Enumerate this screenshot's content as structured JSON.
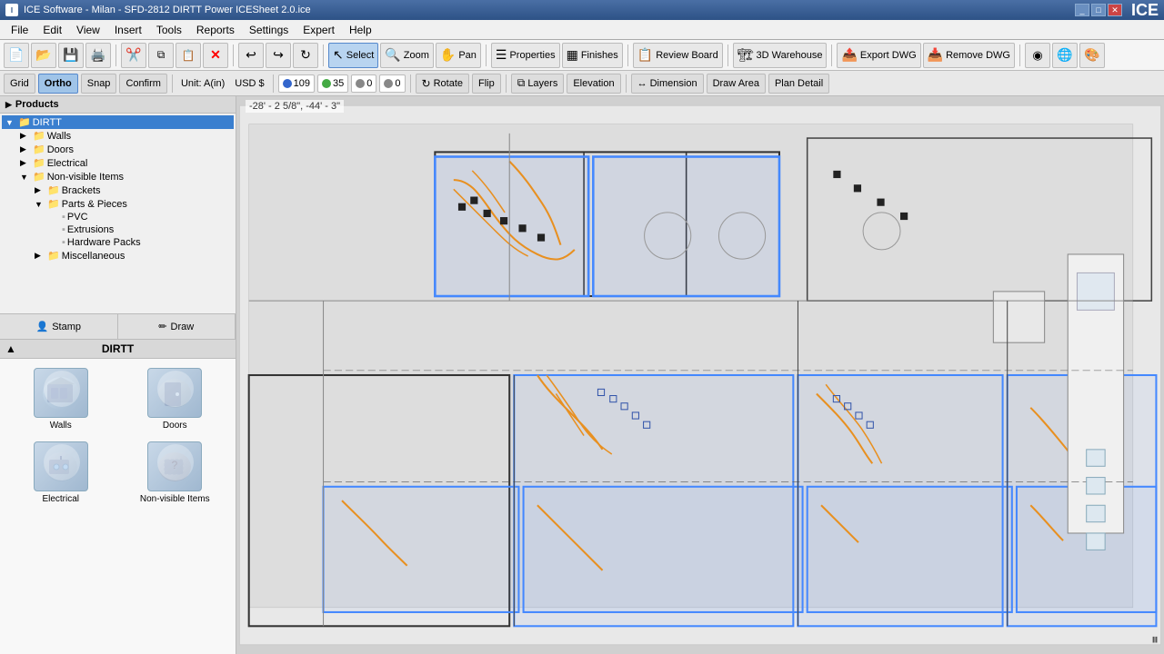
{
  "titleBar": {
    "appName": "ICE Software - Milan - SFD-2812 DIRTT Power ICESheet 2.0.ice",
    "logo": "ICE",
    "winBtns": [
      "_",
      "□",
      "✕"
    ]
  },
  "menuBar": {
    "items": [
      "File",
      "Edit",
      "View",
      "Insert",
      "Tools",
      "Reports",
      "Settings",
      "Expert",
      "Help"
    ]
  },
  "toolbar": {
    "buttons": [
      {
        "id": "new",
        "icon": "📄",
        "label": ""
      },
      {
        "id": "open",
        "icon": "📂",
        "label": ""
      },
      {
        "id": "save",
        "icon": "💾",
        "label": ""
      },
      {
        "id": "print",
        "icon": "🖨️",
        "label": ""
      },
      {
        "id": "sep1"
      },
      {
        "id": "cut",
        "icon": "✂️",
        "label": ""
      },
      {
        "id": "copy",
        "icon": "📋",
        "label": ""
      },
      {
        "id": "paste",
        "icon": "📌",
        "label": ""
      },
      {
        "id": "delete",
        "icon": "✕",
        "label": "",
        "color": "red"
      },
      {
        "id": "sep2"
      },
      {
        "id": "undo",
        "icon": "↩",
        "label": ""
      },
      {
        "id": "redo",
        "icon": "↪",
        "label": ""
      },
      {
        "id": "refresh",
        "icon": "↻",
        "label": ""
      },
      {
        "id": "sep3"
      },
      {
        "id": "select",
        "icon": "↖",
        "label": "Select",
        "active": true
      },
      {
        "id": "zoom",
        "icon": "🔍",
        "label": "Zoom"
      },
      {
        "id": "pan",
        "icon": "✋",
        "label": "Pan"
      },
      {
        "id": "sep4"
      },
      {
        "id": "properties",
        "icon": "≡",
        "label": "Properties"
      },
      {
        "id": "finishes",
        "icon": "▦",
        "label": "Finishes"
      },
      {
        "id": "sep5"
      },
      {
        "id": "reviewboard",
        "icon": "📋",
        "label": "Review Board"
      },
      {
        "id": "sep6"
      },
      {
        "id": "3dwarehouse",
        "icon": "🏗",
        "label": "3D Warehouse"
      },
      {
        "id": "sep7"
      },
      {
        "id": "exportdwg",
        "icon": "📤",
        "label": "Export DWG"
      },
      {
        "id": "removedwg",
        "icon": "📥",
        "label": "Remove DWG"
      },
      {
        "id": "sep8"
      },
      {
        "id": "vr",
        "icon": "◉",
        "label": ""
      },
      {
        "id": "globe",
        "icon": "🌐",
        "label": ""
      },
      {
        "id": "color",
        "icon": "🎨",
        "label": ""
      }
    ]
  },
  "actionBar": {
    "gridBtn": "Grid",
    "orthoBtn": "Ortho",
    "snapBtn": "Snap",
    "confirmBtn": "Confirm",
    "unit": "Unit: A(in)",
    "currency": "USD $",
    "counter1": {
      "icon": "🔵",
      "value": "109"
    },
    "counter2": {
      "icon": "🟢",
      "value": "35"
    },
    "counter3": {
      "icon": "⬛",
      "value": "0"
    },
    "counter4": {
      "icon": "⬛",
      "value": "0"
    },
    "rotateBtn": "Rotate",
    "flipBtn": "Flip",
    "layersBtn": "Layers",
    "elevationBtn": "Elevation",
    "dimensionBtn": "Dimension",
    "drawAreaBtn": "Draw Area",
    "planDetailBtn": "Plan Detail"
  },
  "leftPanel": {
    "header": "Products",
    "treeItems": [
      {
        "id": "dirtt",
        "label": "DIRTT",
        "indent": 0,
        "selected": true,
        "expanded": true,
        "type": "folder"
      },
      {
        "id": "walls",
        "label": "Walls",
        "indent": 1,
        "type": "folder"
      },
      {
        "id": "doors",
        "label": "Doors",
        "indent": 1,
        "type": "folder"
      },
      {
        "id": "electrical",
        "label": "Electrical",
        "indent": 1,
        "type": "folder"
      },
      {
        "id": "nonvisible",
        "label": "Non-visible Items",
        "indent": 1,
        "expanded": true,
        "type": "folder"
      },
      {
        "id": "brackets",
        "label": "Brackets",
        "indent": 2,
        "type": "folder"
      },
      {
        "id": "partspieces",
        "label": "Parts & Pieces",
        "indent": 2,
        "expanded": true,
        "type": "folder"
      },
      {
        "id": "pvc",
        "label": "PVC",
        "indent": 3,
        "type": "item"
      },
      {
        "id": "extrusions",
        "label": "Extrusions",
        "indent": 3,
        "type": "item"
      },
      {
        "id": "hardwarepacks",
        "label": "Hardware Packs",
        "indent": 3,
        "type": "item"
      },
      {
        "id": "miscellaneous",
        "label": "Miscellaneous",
        "indent": 2,
        "type": "folder"
      }
    ],
    "stampDrawTabs": [
      {
        "id": "stamp",
        "label": "Stamp",
        "icon": "👤",
        "active": false
      },
      {
        "id": "draw",
        "label": "Draw",
        "icon": "✏",
        "active": false
      }
    ],
    "productPanelTitle": "DIRTT",
    "products": [
      {
        "id": "walls",
        "label": "Walls"
      },
      {
        "id": "doors",
        "label": "Doors"
      },
      {
        "id": "electrical",
        "label": "Electrical"
      },
      {
        "id": "nonvisible",
        "label": "Non-visible Items"
      }
    ]
  },
  "canvas": {
    "coordinates": "-28' - 2 5/8\", -44' - 3\""
  }
}
